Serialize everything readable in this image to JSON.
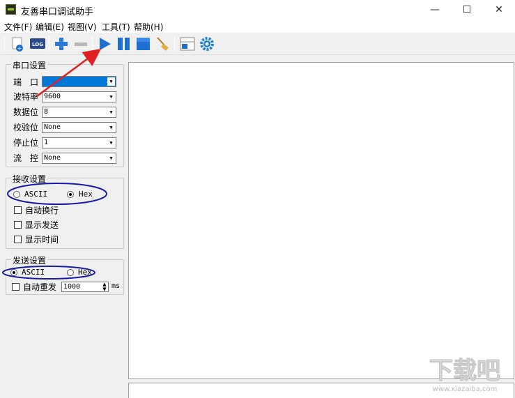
{
  "window": {
    "title": "友善串口调试助手",
    "controls": {
      "minimize": "—",
      "maximize": "☐",
      "close": "✕"
    }
  },
  "menu": [
    "文件(F)",
    "编辑(E)",
    "视图(V)",
    "工具(T)",
    "帮助(H)"
  ],
  "toolbar": {
    "log_label": "LOG",
    "buttons": [
      "new-icon",
      "log-icon",
      "add-icon",
      "remove-icon",
      "play-icon",
      "pause-icon",
      "stop-icon",
      "clear-icon",
      "layout-icon",
      "settings-icon"
    ]
  },
  "serial_settings": {
    "title": "串口设置",
    "port": {
      "label": "端　口",
      "value": ""
    },
    "baud": {
      "label": "波特率",
      "value": "9600"
    },
    "data_bits": {
      "label": "数据位",
      "value": "8"
    },
    "parity": {
      "label": "校验位",
      "value": "None"
    },
    "stop_bits": {
      "label": "停止位",
      "value": "1"
    },
    "flow": {
      "label": "流　控",
      "value": "None"
    }
  },
  "receive_settings": {
    "title": "接收设置",
    "ascii_label": "ASCII",
    "hex_label": "Hex",
    "selected": "Hex",
    "auto_newline": "自动换行",
    "show_send": "显示发送",
    "show_time": "显示时间"
  },
  "send_settings": {
    "title": "发送设置",
    "ascii_label": "ASCII",
    "hex_label": "Hex",
    "selected": "ASCII",
    "auto_resend": "自动重发",
    "interval_value": "1000",
    "interval_unit": "ms"
  },
  "annotation_colors": {
    "arrow": "#e02020",
    "ellipse": "#1a1aa8"
  },
  "watermark": {
    "text": "下载吧",
    "url": "www.xiazaiba.com"
  }
}
